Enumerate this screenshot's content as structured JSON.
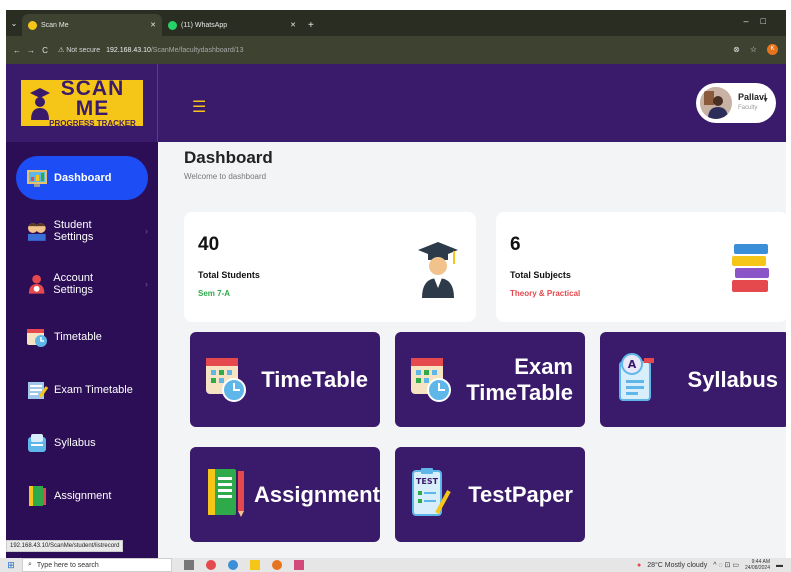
{
  "browser": {
    "tabs": [
      {
        "title": "Scan Me",
        "active": true
      },
      {
        "title": "(11) WhatsApp",
        "active": false
      }
    ],
    "security_label": "Not secure",
    "url_host": "192.168.43.10",
    "url_path": "/ScanMe/facultydashboard/13",
    "profile_initial": "K"
  },
  "app": {
    "logo_title": "SCAN ME",
    "logo_subtitle": "PROGRESS TRACKER",
    "user": {
      "name": "Pallavi",
      "role": "Faculty"
    }
  },
  "sidebar": {
    "items": [
      {
        "label": "Dashboard",
        "icon": "dashboard-icon",
        "active": true,
        "has_chevron": false
      },
      {
        "label": "Student Settings",
        "icon": "students-icon",
        "active": false,
        "has_chevron": true
      },
      {
        "label": "Account Settings",
        "icon": "account-icon",
        "active": false,
        "has_chevron": true
      },
      {
        "label": "Timetable",
        "icon": "timetable-icon",
        "active": false,
        "has_chevron": false
      },
      {
        "label": "Exam Timetable",
        "icon": "exam-timetable-icon",
        "active": false,
        "has_chevron": false
      },
      {
        "label": "Syllabus",
        "icon": "syllabus-icon",
        "active": false,
        "has_chevron": false
      },
      {
        "label": "Assignment",
        "icon": "assignment-icon",
        "active": false,
        "has_chevron": false
      }
    ]
  },
  "status_url": "192.168.43.10/ScanMe/student/listrecord",
  "main": {
    "title": "Dashboard",
    "subtitle": "Welcome to dashboard",
    "stats": [
      {
        "value": "40",
        "label": "Total Students",
        "note": "Sem 7-A",
        "note_color": "#2eaa4a",
        "icon": "graduate-icon"
      },
      {
        "value": "6",
        "label": "Total Subjects",
        "note": "Theory & Practical",
        "note_color": "#e5484d",
        "icon": "books-icon"
      }
    ],
    "tiles": [
      {
        "label": "TimeTable",
        "icon": "calendar-clock-icon"
      },
      {
        "label": "Exam TimeTable",
        "icon": "exam-calendar-icon"
      },
      {
        "label": "Syllabus",
        "icon": "syllabus-doc-icon"
      },
      {
        "label": "Assignment",
        "icon": "notebook-icon"
      },
      {
        "label": "TestPaper",
        "icon": "test-paper-icon"
      }
    ]
  },
  "taskbar": {
    "search_placeholder": "Type here to search",
    "weather": "28°C  Mostly cloudy",
    "time": "9:44 AM",
    "date": "24/08/2024"
  },
  "colors": {
    "brand_purple": "#3a1a6b",
    "sidebar_bg": "#2b0e55",
    "accent_yellow": "#f5c518",
    "active_blue": "#1d4ef5"
  }
}
